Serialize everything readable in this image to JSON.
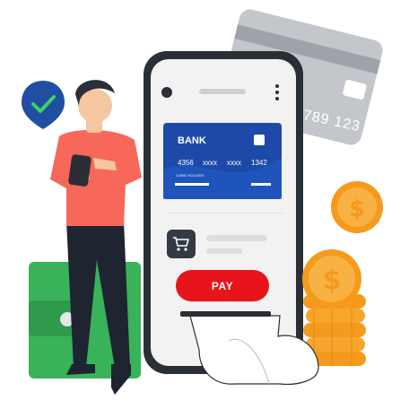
{
  "bank_card": {
    "bank_label": "BANK",
    "number_groups": [
      "4356",
      "xxxx",
      "xxxx",
      "1342"
    ],
    "holder_label": "CARD HOLDER"
  },
  "back_card": {
    "digits": "789 123"
  },
  "pay_button": {
    "label": "PAY"
  },
  "colors": {
    "accent_red": "#e8141b",
    "card_blue": "#1d4aa8",
    "check_badge_blue": "#1f4ea3",
    "wallet_green": "#38b35a",
    "coin_orange": "#f59a1d",
    "shirt_coral": "#f7685a"
  },
  "icons": {
    "check": "check-badge-icon",
    "cart": "shopping-cart-icon",
    "menu": "kebab-menu-icon",
    "dollar": "dollar-coin-icon"
  }
}
